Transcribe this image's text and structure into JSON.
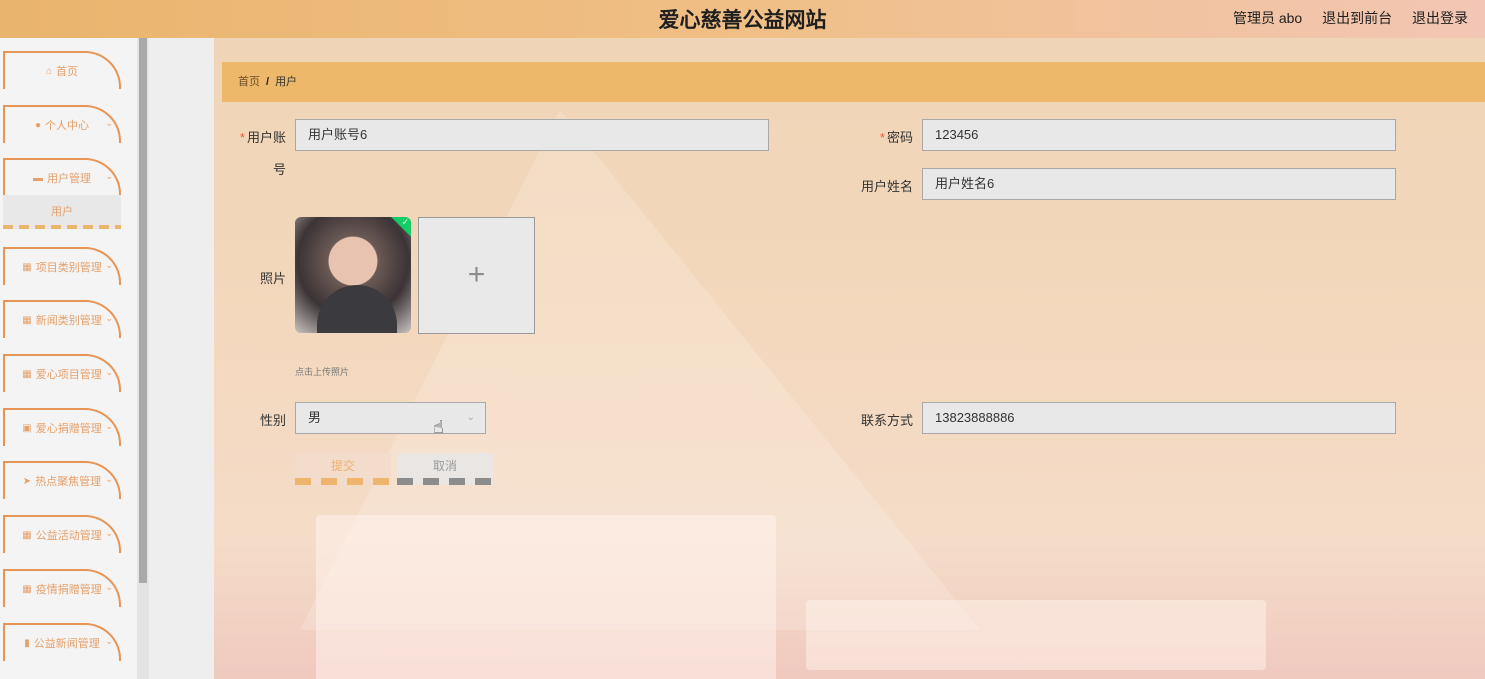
{
  "header": {
    "title": "爱心慈善公益网站",
    "user": "管理员 abo",
    "frontend_link": "退出到前台",
    "logout_link": "退出登录"
  },
  "sidebar": {
    "items": [
      {
        "label": "首页",
        "icon": "home-icon"
      },
      {
        "label": "个人中心",
        "icon": "person-icon"
      },
      {
        "label": "用户管理",
        "icon": "card-icon"
      },
      {
        "label": "项目类别管理",
        "icon": "grid-icon"
      },
      {
        "label": "新闻类别管理",
        "icon": "grid-icon"
      },
      {
        "label": "爱心项目管理",
        "icon": "grid-icon"
      },
      {
        "label": "爱心捐赠管理",
        "icon": "image-icon"
      },
      {
        "label": "热点聚焦管理",
        "icon": "send-icon"
      },
      {
        "label": "公益活动管理",
        "icon": "grid-icon"
      },
      {
        "label": "疫情捐赠管理",
        "icon": "grid-icon"
      },
      {
        "label": "公益新闻管理",
        "icon": "chart-icon"
      }
    ],
    "submenu_label": "用户"
  },
  "breadcrumb": {
    "home": "首页",
    "separator": "/",
    "current": "用户"
  },
  "form": {
    "account_label_1": "用户账",
    "account_label_2": "号",
    "account_value": "用户账号6",
    "password_label": "密码",
    "password_value": "123456",
    "name_label": "用户姓名",
    "name_value": "用户姓名6",
    "photo_label": "照片",
    "upload_plus": "+",
    "upload_hint": "点击上传照片",
    "gender_label": "性别",
    "gender_value": "男",
    "contact_label": "联系方式",
    "contact_value": "13823888886",
    "required_mark": "*",
    "submit_label": "提交",
    "cancel_label": "取消"
  }
}
